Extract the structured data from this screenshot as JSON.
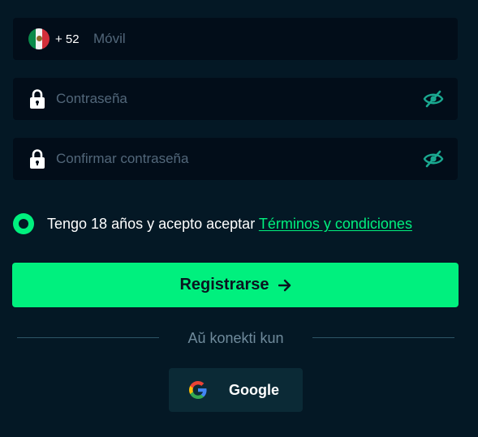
{
  "phone": {
    "country_flag": "mexico-flag-icon",
    "prefix": "+ 52",
    "placeholder": "Móvil",
    "value": ""
  },
  "password": {
    "icon": "lock-icon",
    "placeholder": "Contraseña",
    "value": "",
    "toggle_icon": "eye-slash-icon"
  },
  "confirm_password": {
    "icon": "lock-icon",
    "placeholder": "Confirmar contraseña",
    "value": "",
    "toggle_icon": "eye-slash-icon"
  },
  "terms": {
    "text": "Tengo 18 años y acepto aceptar ",
    "link_label": "Términos y condiciones",
    "checked": true
  },
  "register": {
    "label": "Registrarse",
    "icon": "arrow-right-icon"
  },
  "social": {
    "divider_text": "Aŭ konekti kun",
    "google_label": "Google",
    "google_icon": "google-icon"
  },
  "colors": {
    "background": "#041825",
    "field_background": "#020d19",
    "accent": "#00f07e",
    "eye_icon": "#1aa890",
    "placeholder": "#52677a",
    "google_button": "#0b2a36"
  }
}
